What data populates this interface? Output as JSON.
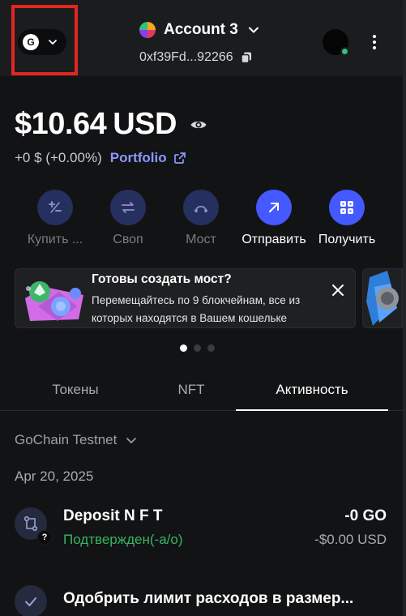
{
  "header": {
    "network_badge": "G",
    "account_name": "Account 3",
    "address": "0xf39Fd...92266"
  },
  "balance": {
    "amount": "$10.64",
    "currency": "USD",
    "change": "+0 $ (+0.00%)",
    "portfolio_label": "Portfolio"
  },
  "actions": [
    {
      "label": "Купить ...",
      "enabled": false
    },
    {
      "label": "Своп",
      "enabled": false
    },
    {
      "label": "Мост",
      "enabled": false
    },
    {
      "label": "Отправить",
      "enabled": true
    },
    {
      "label": "Получить",
      "enabled": true
    }
  ],
  "banner": {
    "title": "Готовы создать мост?",
    "body": "Перемещайтесь по 9 блокчейнам, все из которых находятся в Вашем кошельке"
  },
  "tabs": [
    {
      "label": "Токены",
      "active": false
    },
    {
      "label": "NFT",
      "active": false
    },
    {
      "label": "Активность",
      "active": true
    }
  ],
  "network_filter": "GoChain Testnet",
  "activity": {
    "date": "Apr 20, 2025",
    "items": [
      {
        "title": "Deposit N F T",
        "status": "Подтвержден(-а/о)",
        "amount": "-0 GO",
        "fiat": "-$0.00 USD",
        "badge": "?"
      },
      {
        "title": "Одобрить лимит расходов в размер..."
      }
    ]
  },
  "colors": {
    "background": "#121314",
    "accent": "#4459ff",
    "link": "#8b99ff",
    "success": "#38b561",
    "highlight": "#e2261f"
  },
  "icons": {
    "network_chevron": "chevron-down-icon",
    "copy": "copy-icon",
    "eye": "eye-icon",
    "external": "external-link-icon",
    "close": "close-icon",
    "more": "kebab-menu-icon"
  }
}
